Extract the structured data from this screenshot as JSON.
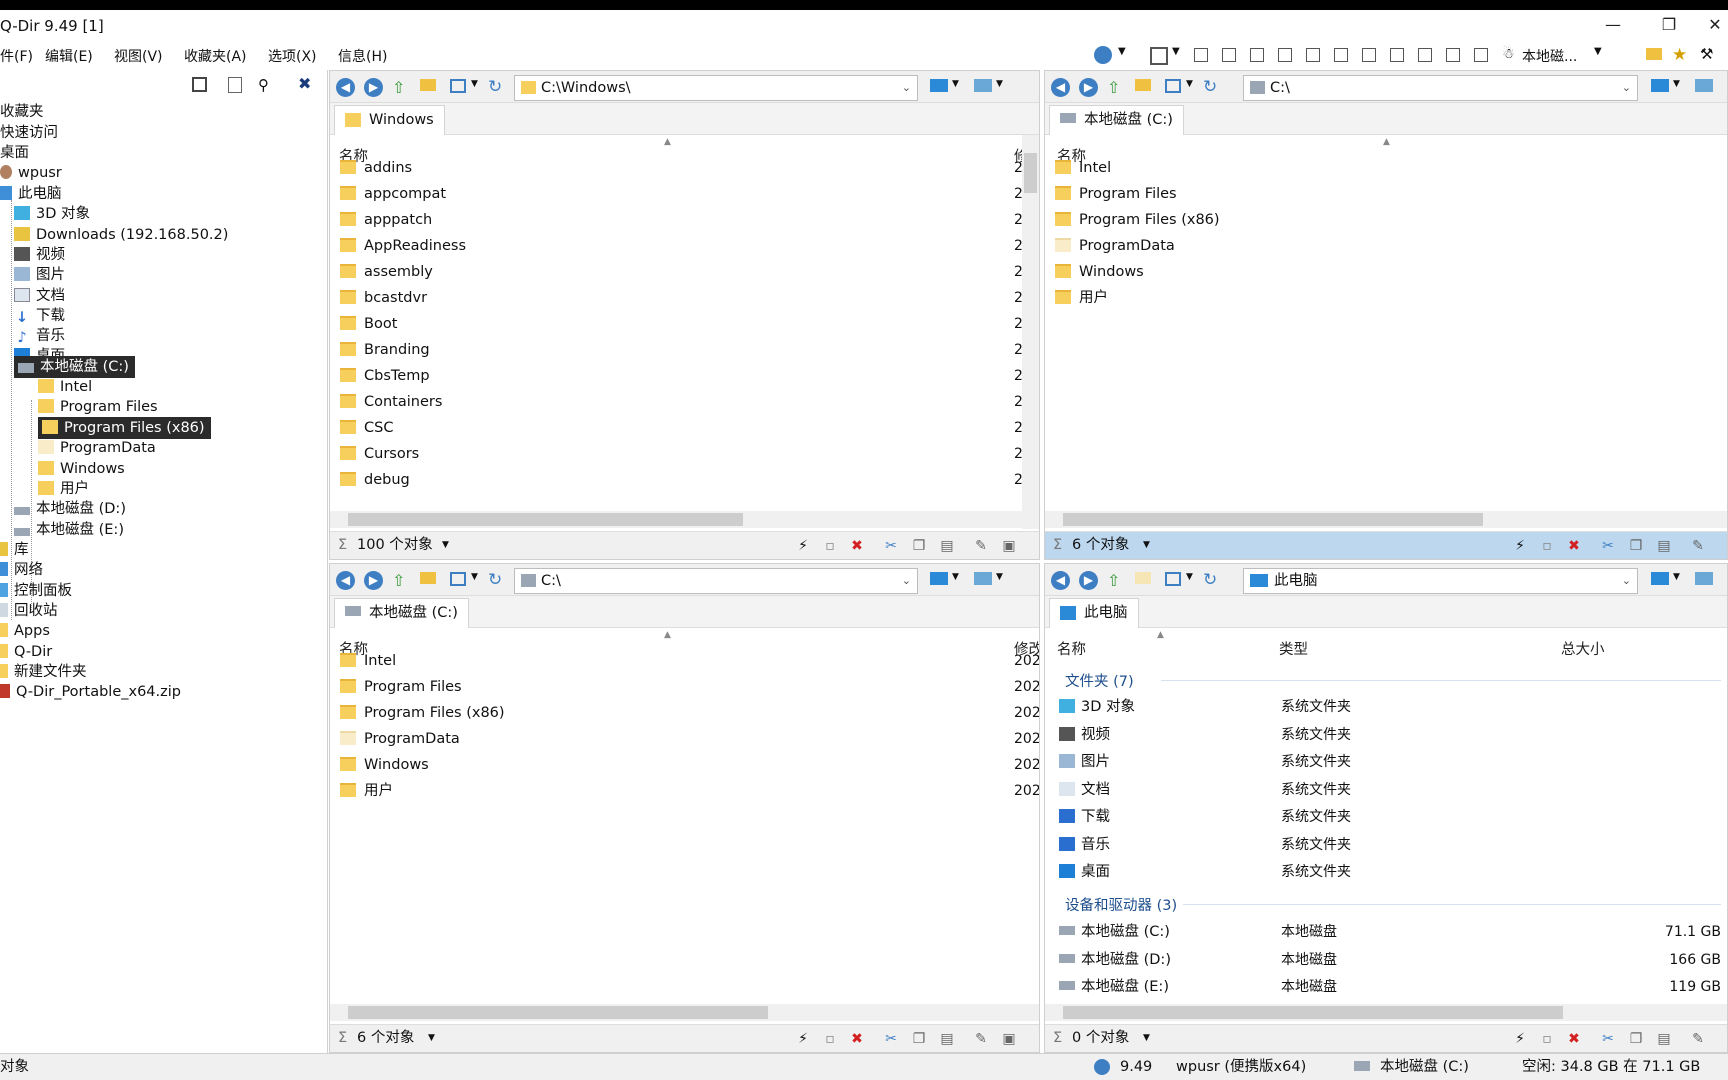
{
  "app": {
    "title": "Q-Dir 9.49 [1]",
    "version": "9.49"
  },
  "menu": [
    "件(F)",
    "编辑(E)",
    "视图(V)",
    "收藏夹(A)",
    "选项(X)",
    "信息(H)"
  ],
  "toolbar_right": {
    "drive_label": "本地磁..."
  },
  "tree": {
    "items": [
      {
        "label": "收藏夹",
        "icon": "star-icon"
      },
      {
        "label": "快速访问",
        "icon": "star-icon"
      },
      {
        "label": "桌面",
        "icon": "desktop-icon"
      },
      {
        "label": "wpusr",
        "icon": "user-icon"
      },
      {
        "label": "此电脑",
        "icon": "computer-icon"
      },
      {
        "label": "3D 对象",
        "icon": "cube-icon"
      },
      {
        "label": "Downloads (192.168.50.2)",
        "icon": "network-drive-icon"
      },
      {
        "label": "视频",
        "icon": "video-icon"
      },
      {
        "label": "图片",
        "icon": "picture-icon"
      },
      {
        "label": "文档",
        "icon": "document-icon"
      },
      {
        "label": "下载",
        "icon": "download-icon"
      },
      {
        "label": "音乐",
        "icon": "music-icon"
      },
      {
        "label": "桌面",
        "icon": "desktop-icon"
      },
      {
        "label": "本地磁盘 (C:)",
        "icon": "drive-icon"
      },
      {
        "label": "Intel",
        "icon": "folder-icon"
      },
      {
        "label": "Program Files",
        "icon": "folder-icon"
      },
      {
        "label": "Program Files (x86)",
        "icon": "folder-icon"
      },
      {
        "label": "ProgramData",
        "icon": "folder-icon"
      },
      {
        "label": "Windows",
        "icon": "folder-icon"
      },
      {
        "label": "用户",
        "icon": "folder-icon"
      },
      {
        "label": "本地磁盘 (D:)",
        "icon": "drive-icon"
      },
      {
        "label": "本地磁盘 (E:)",
        "icon": "drive-icon"
      },
      {
        "label": "库",
        "icon": "library-icon"
      },
      {
        "label": "网络",
        "icon": "network-icon"
      },
      {
        "label": "控制面板",
        "icon": "control-panel-icon"
      },
      {
        "label": "回收站",
        "icon": "recycle-bin-icon"
      },
      {
        "label": "Apps",
        "icon": "folder-icon"
      },
      {
        "label": "Q-Dir",
        "icon": "folder-icon"
      },
      {
        "label": "新建文件夹",
        "icon": "folder-icon"
      },
      {
        "label": "Q-Dir_Portable_x64.zip",
        "icon": "zip-icon"
      }
    ]
  },
  "pane1": {
    "address": "C:\\Windows\\",
    "tab": "Windows",
    "col_name": "名称",
    "col2": "修",
    "files": [
      "addins",
      "appcompat",
      "apppatch",
      "AppReadiness",
      "assembly",
      "bcastdvr",
      "Boot",
      "Branding",
      "CbsTemp",
      "Containers",
      "CSC",
      "Cursors",
      "debug"
    ],
    "col2_value": "2",
    "status": "100 个对象"
  },
  "pane2": {
    "address": "C:\\",
    "tab": "本地磁盘 (C:)",
    "col_name": "名称",
    "files": [
      {
        "name": "Intel",
        "light": false
      },
      {
        "name": "Program Files",
        "light": false
      },
      {
        "name": "Program Files (x86)",
        "light": false
      },
      {
        "name": "ProgramData",
        "light": true
      },
      {
        "name": "Windows",
        "light": false
      },
      {
        "name": "用户",
        "light": false
      }
    ],
    "status": "6 个对象"
  },
  "pane3": {
    "address": "C:\\",
    "tab": "本地磁盘 (C:)",
    "col_name": "名称",
    "col2": "修改",
    "files": [
      {
        "name": "Intel",
        "date": "202",
        "light": false
      },
      {
        "name": "Program Files",
        "date": "202",
        "light": false
      },
      {
        "name": "Program Files (x86)",
        "date": "202",
        "light": false
      },
      {
        "name": "ProgramData",
        "date": "202",
        "light": true
      },
      {
        "name": "Windows",
        "date": "202",
        "light": false
      },
      {
        "name": "用户",
        "date": "202",
        "light": false
      }
    ],
    "status": "6 个对象"
  },
  "pane4": {
    "address": "此电脑",
    "tab": "此电脑",
    "col_name": "名称",
    "col_type": "类型",
    "col_size": "总大小",
    "group_folders": "文件夹 (7)",
    "folders": [
      {
        "name": "3D 对象",
        "type": "系统文件夹",
        "icon": "cube-icon"
      },
      {
        "name": "视频",
        "type": "系统文件夹",
        "icon": "video-icon"
      },
      {
        "name": "图片",
        "type": "系统文件夹",
        "icon": "picture-icon"
      },
      {
        "name": "文档",
        "type": "系统文件夹",
        "icon": "document-icon"
      },
      {
        "name": "下载",
        "type": "系统文件夹",
        "icon": "download-icon"
      },
      {
        "name": "音乐",
        "type": "系统文件夹",
        "icon": "music-icon"
      },
      {
        "name": "桌面",
        "type": "系统文件夹",
        "icon": "desktop-icon"
      }
    ],
    "group_drives": "设备和驱动器 (3)",
    "drives": [
      {
        "name": "本地磁盘 (C:)",
        "type": "本地磁盘",
        "size": "71.1 GB"
      },
      {
        "name": "本地磁盘 (D:)",
        "type": "本地磁盘",
        "size": "166 GB"
      },
      {
        "name": "本地磁盘 (E:)",
        "type": "本地磁盘",
        "size": "119 GB"
      }
    ],
    "status": "0 个对象"
  },
  "bottom": {
    "left": "对象",
    "version": "9.49",
    "user": "wpusr (便携版x64)",
    "drive": "本地磁盘 (C:)",
    "free": "空闲: 34.8 GB 在 71.1 GB"
  },
  "colors": {
    "accent": "#3e7fc4",
    "folder": "#f7cf5c",
    "status_active": "#bcd7ee",
    "delete": "#d32020"
  }
}
